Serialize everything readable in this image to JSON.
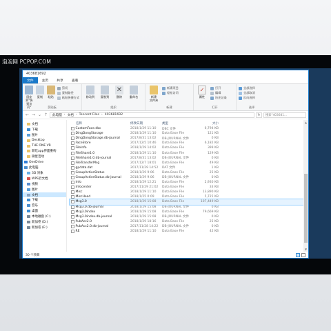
{
  "watermark": "泡泡网 PCPOP.COM",
  "window": {
    "title": "403681692"
  },
  "tabs": [
    {
      "id": "file",
      "label": "文件"
    },
    {
      "id": "home",
      "label": "主页"
    },
    {
      "id": "share",
      "label": "共享"
    },
    {
      "id": "view",
      "label": "查看"
    }
  ],
  "ribbon": {
    "clipboard": {
      "label": "剪贴板",
      "pin": "固定到\"快\n速访问\"",
      "copy": "复制",
      "paste": "粘贴",
      "cut": "剪切",
      "copy_path": "复制路径",
      "paste_shortcut": "粘贴快捷方式"
    },
    "organize": {
      "label": "组织",
      "move_to": "移动到",
      "copy_to": "复制到",
      "delete": "删除",
      "rename": "重命名"
    },
    "new": {
      "label": "新建",
      "new_folder": "新建\n文件夹",
      "new_item": "新建项目",
      "easy_access": "轻松访问"
    },
    "open": {
      "label": "打开",
      "properties": "属性",
      "open": "打开",
      "edit": "编辑",
      "history": "历史记录"
    },
    "select": {
      "label": "选择",
      "select_all": "全部选择",
      "select_none": "全部取消",
      "invert": "反向选择"
    }
  },
  "address": {
    "crumbs": [
      "此电脑",
      "文档",
      "Tencent Files",
      "403681692"
    ],
    "search_placeholder": "搜索\"403681..."
  },
  "nav": [
    {
      "label": "文档",
      "icon": "folder-icon",
      "color": "#e9c46a"
    },
    {
      "label": "下载",
      "icon": "download-icon",
      "color": "#3c8fd6"
    },
    {
      "label": "图片",
      "icon": "pictures-icon",
      "color": "#5aa0dc"
    },
    {
      "label": "Desktop",
      "icon": "folder-icon",
      "color": "#e9c46a"
    },
    {
      "label": "THE ONE VR",
      "icon": "folder-icon",
      "color": "#e9c46a"
    },
    {
      "label": "新吃app界面重构",
      "icon": "folder-icon",
      "color": "#e9c46a"
    },
    {
      "label": "微星活动",
      "icon": "folder-icon",
      "color": "#e9c46a"
    },
    {
      "label": "OneDrive",
      "icon": "cloud-icon",
      "color": "#2f7ed8"
    },
    {
      "label": "此电脑",
      "icon": "pc-icon",
      "color": "#4b8fd0"
    },
    {
      "label": "3D 对象",
      "icon": "objects-icon",
      "color": "#6ab0e6"
    },
    {
      "label": "WPS云文档",
      "icon": "cloud-icon",
      "color": "#d9534f"
    },
    {
      "label": "视频",
      "icon": "video-icon",
      "color": "#5a8fd0"
    },
    {
      "label": "图片",
      "icon": "pictures-icon",
      "color": "#5aa0dc"
    },
    {
      "label": "文档",
      "icon": "documents-icon",
      "color": "#8aa4c2"
    },
    {
      "label": "下载",
      "icon": "download-icon",
      "color": "#3c8fd6"
    },
    {
      "label": "音乐",
      "icon": "music-icon",
      "color": "#4b8fd0"
    },
    {
      "label": "桌面",
      "icon": "desktop-icon",
      "color": "#3c8fd6"
    },
    {
      "label": "本地磁盘 (C:)",
      "icon": "drive-icon",
      "color": "#7a8a9a"
    },
    {
      "label": "新加卷 (D:)",
      "icon": "drive-icon",
      "color": "#7a8a9a"
    },
    {
      "label": "新加卷 (E:)",
      "icon": "drive-icon",
      "color": "#7a8a9a"
    }
  ],
  "columns": {
    "name": "名称",
    "date": "修改日期",
    "type": "类型",
    "size": "大小"
  },
  "files": [
    {
      "name": "CustomFace.dbc",
      "date": "2018/1/29 11:10",
      "type": "DBC 文件",
      "size": "6,794 KB"
    },
    {
      "name": "DingDongStorage",
      "date": "2018/1/29 11:10",
      "type": "Data Base File",
      "size": "121 KB"
    },
    {
      "name": "DingDongStorage.db-journal",
      "date": "2017/8/31 13:02",
      "type": "DB-JOURNAL 文件",
      "size": "0 KB"
    },
    {
      "name": "FaceStore",
      "date": "2017/12/5 10:46",
      "type": "Data Base File",
      "size": "6,182 KB"
    },
    {
      "name": "FileInfo",
      "date": "2018/1/29 14:02",
      "type": "Data Base File",
      "size": "399 KB"
    },
    {
      "name": "FileShare1.0",
      "date": "2018/1/29 11:10",
      "type": "Data Base File",
      "size": "129 KB"
    },
    {
      "name": "FileShare1.0.db-journal",
      "date": "2017/8/31 13:02",
      "type": "DB-JOURNAL 文件",
      "size": "0 KB"
    },
    {
      "name": "FileTransferMsg",
      "date": "2017/12/7 18:01",
      "type": "Data Base File",
      "size": "49 KB"
    },
    {
      "name": "gpdata.dat",
      "date": "2017/11/29 14:52",
      "type": "DAT 文件",
      "size": "1 KB"
    },
    {
      "name": "GroupActiveStatus",
      "date": "2018/1/29 9:06",
      "type": "Data Base File",
      "size": "25 KB"
    },
    {
      "name": "GroupActiveStatus.db-journal",
      "date": "2018/1/29 9:06",
      "type": "DB-JOURNAL 文件",
      "size": "0 KB"
    },
    {
      "name": "Info",
      "date": "2018/1/29 12:21",
      "type": "Data Base File",
      "size": "2,930 KB"
    },
    {
      "name": "Infocenter",
      "date": "2017/11/29 21:02",
      "type": "Data Base File",
      "size": "33 KB"
    },
    {
      "name": "Misc",
      "date": "2018/1/29 11:10",
      "type": "Data Base File",
      "size": "13,890 KB"
    },
    {
      "name": "MiscHead",
      "date": "2018/1/25 0:09",
      "type": "Data Base File",
      "size": "5,725 KB"
    },
    {
      "name": "Msg3.0",
      "date": "2018/1/29 15:08",
      "type": "Data Base File",
      "size": "107,449 KB",
      "selected": true
    },
    {
      "name": "Msg3.0.db-journal",
      "date": "2018/1/29 15:08",
      "type": "DB-JOURNAL 文件",
      "size": "0 KB"
    },
    {
      "name": "Msg3.0index",
      "date": "2018/1/29 15:08",
      "type": "Data Base File",
      "size": "79,669 KB"
    },
    {
      "name": "Msg3.0index.db-journal",
      "date": "2018/1/29 15:08",
      "type": "DB-JOURNAL 文件",
      "size": "0 KB"
    },
    {
      "name": "PubAcc2.0",
      "date": "2018/1/29 18:16",
      "type": "Data Base File",
      "size": "25 KB"
    },
    {
      "name": "PubAcc2.0.db-journal",
      "date": "2017/11/28 14:22",
      "type": "DB-JOURNAL 文件",
      "size": "0 KB"
    },
    {
      "name": "RE",
      "date": "2018/1/29 11:10",
      "type": "Data Base File",
      "size": "42 KB"
    }
  ],
  "status": {
    "count": "30 个项目"
  }
}
